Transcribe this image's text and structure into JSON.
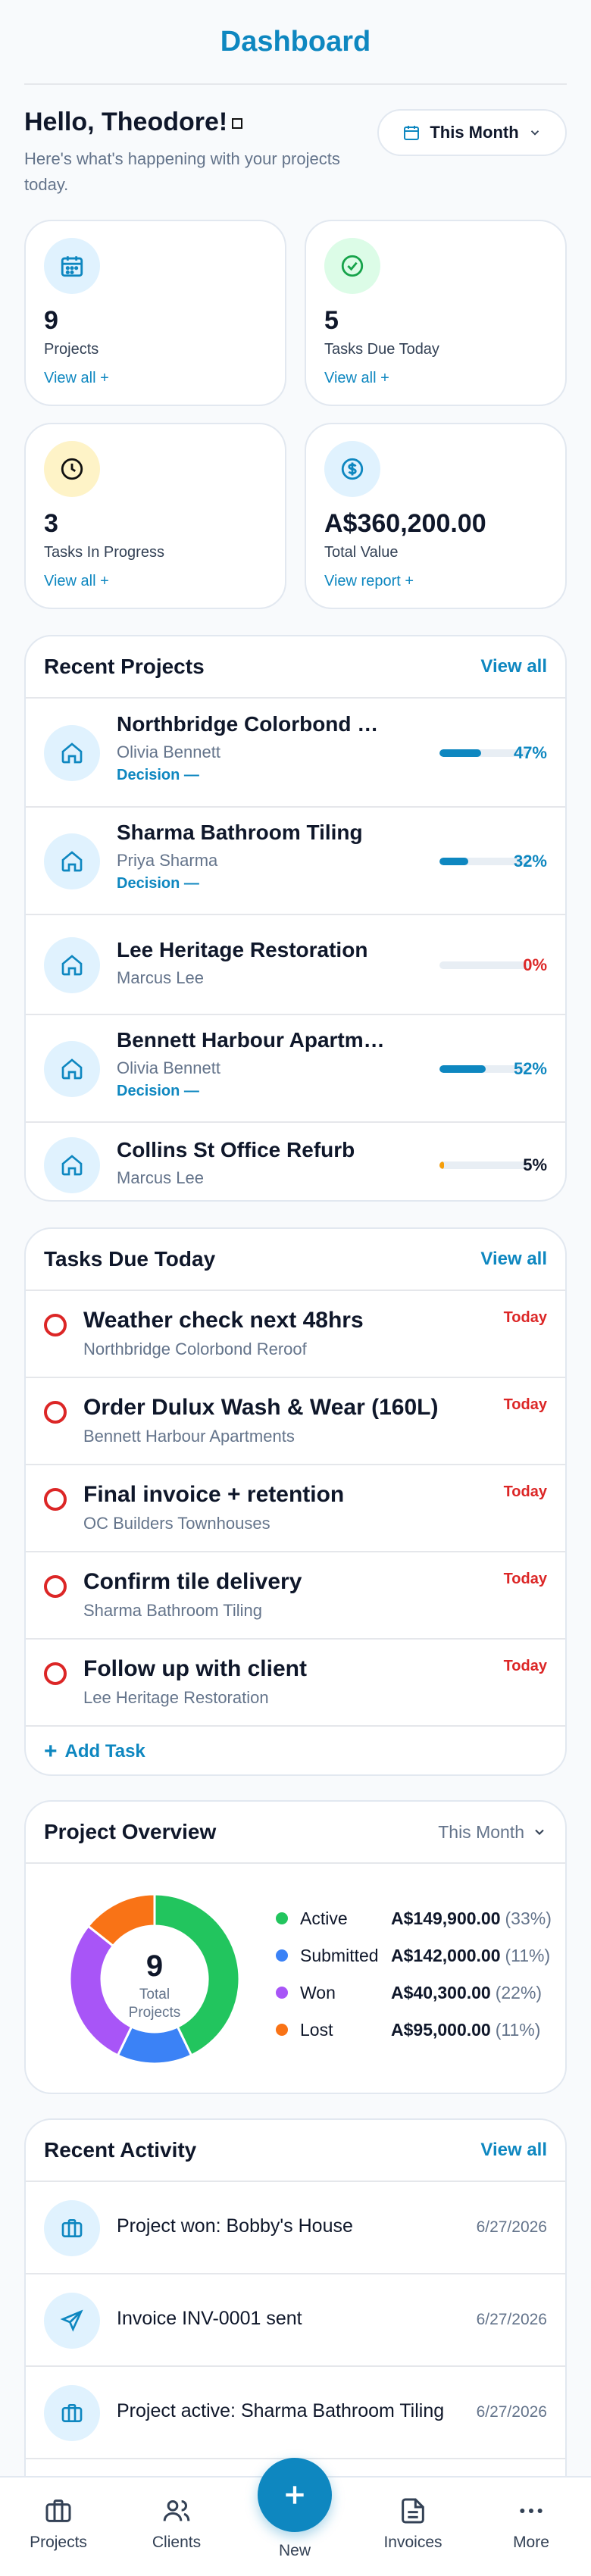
{
  "header": {
    "title": "Dashboard"
  },
  "greeting": {
    "title": "Hello, Theodore!",
    "subtitle": "Here's what's happening with your projects today."
  },
  "period_filter": {
    "label": "This Month"
  },
  "stats": [
    {
      "value": "9",
      "label": "Projects",
      "link": "View all +",
      "icon": "calendar-icon",
      "color": "#0e87c0"
    },
    {
      "value": "5",
      "label": "Tasks Due Today",
      "link": "View all +",
      "icon": "check-circle-icon",
      "color": "#16a34a"
    },
    {
      "value": "3",
      "label": "Tasks In Progress",
      "link": "View all +",
      "icon": "clock-icon",
      "color": "#92400e"
    },
    {
      "value": "A$360,200.00",
      "label": "Total Value",
      "link": "View report +",
      "icon": "dollar-icon",
      "color": "#0e87c0"
    }
  ],
  "recent_projects": {
    "title": "Recent Projects",
    "view_all": "View all",
    "items": [
      {
        "name": "Northbridge Colorbond Reroof",
        "client": "Olivia Bennett",
        "status": "Decision —",
        "progress": 0.47,
        "pct": "47%",
        "pct_color": "#0e87c0",
        "bar_color": "#0e87c0"
      },
      {
        "name": "Sharma Bathroom Tiling",
        "client": "Priya Sharma",
        "status": "Decision —",
        "progress": 0.32,
        "pct": "32%",
        "pct_color": "#0e87c0",
        "bar_color": "#0e87c0"
      },
      {
        "name": "Lee Heritage Restoration",
        "client": "Marcus Lee",
        "status": "",
        "progress": 0,
        "pct": "0%",
        "pct_color": "#dc2626",
        "bar_color": "#dc2626"
      },
      {
        "name": "Bennett Harbour Apartments",
        "client": "Olivia Bennett",
        "status": "Decision —",
        "progress": 0.52,
        "pct": "52%",
        "pct_color": "#0e87c0",
        "bar_color": "#0e87c0"
      },
      {
        "name": "Collins St Office Refurb",
        "client": "Marcus Lee",
        "status": "",
        "progress": 0.05,
        "pct": "5%",
        "pct_color": "#0f172a",
        "bar_color": "#f59e0b"
      }
    ]
  },
  "tasks_due": {
    "title": "Tasks Due Today",
    "view_all": "View all",
    "items": [
      {
        "title": "Weather check next 48hrs",
        "project": "Northbridge Colorbond Reroof",
        "due": "Today"
      },
      {
        "title": "Order Dulux Wash & Wear (160L)",
        "project": "Bennett Harbour Apartments",
        "due": "Today"
      },
      {
        "title": "Final invoice + retention",
        "project": "OC Builders Townhouses",
        "due": "Today"
      },
      {
        "title": "Confirm tile delivery",
        "project": "Sharma Bathroom Tiling",
        "due": "Today"
      },
      {
        "title": "Follow up with client",
        "project": "Lee Heritage Restoration",
        "due": "Today"
      }
    ],
    "add_label": "Add Task"
  },
  "overview": {
    "title": "Project Overview",
    "period": "This Month",
    "center_value": "9",
    "center_label": "Total Projects",
    "legend": [
      {
        "name": "Active",
        "amount": "A$149,900.00",
        "pct": "(33%)",
        "color": "#22c55e"
      },
      {
        "name": "Submitted",
        "amount": "A$142,000.00",
        "pct": "(11%)",
        "color": "#3b82f6"
      },
      {
        "name": "Won",
        "amount": "A$40,300.00",
        "pct": "(22%)",
        "color": "#a855f7"
      },
      {
        "name": "Lost",
        "amount": "A$95,000.00",
        "pct": "(11%)",
        "color": "#f97316"
      }
    ]
  },
  "chart_data": {
    "type": "pie",
    "categories": [
      "Active",
      "Submitted",
      "Won",
      "Lost"
    ],
    "values": [
      33,
      11,
      22,
      11
    ],
    "title": "Project Overview",
    "center_value": "9",
    "center_label": "Total Projects",
    "colors": [
      "#22c55e",
      "#3b82f6",
      "#a855f7",
      "#f97316"
    ]
  },
  "activity": {
    "title": "Recent Activity",
    "view_all": "View all",
    "items": [
      {
        "text": "Project won: Bobby's House",
        "date": "6/27/2026",
        "icon": "briefcase-icon"
      },
      {
        "text": "Invoice INV-0001 sent",
        "date": "6/27/2026",
        "icon": "send-icon"
      },
      {
        "text": "Project active: Sharma Bathroom Tiling",
        "date": "6/27/2026",
        "icon": "briefcase-icon"
      }
    ]
  },
  "nav": {
    "projects": "Projects",
    "clients": "Clients",
    "new": "New",
    "invoices": "Invoices",
    "more": "More"
  }
}
